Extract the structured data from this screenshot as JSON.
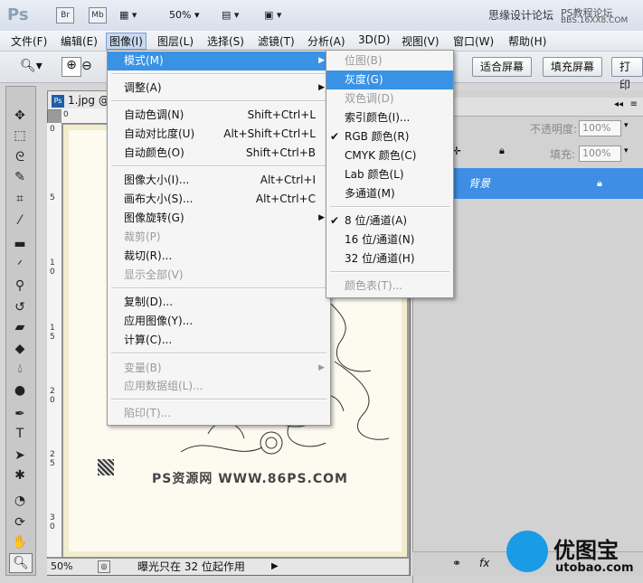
{
  "titlebar": {
    "app_logo": "Ps",
    "br_label": "Br",
    "mb_label": "Mb",
    "zoom": "50%",
    "right_text": "思缘设计论坛",
    "right_text2": "PS教程论坛",
    "right_url": "BBS.16XX8.COM"
  },
  "menubar": {
    "items": [
      "文件(F)",
      "编辑(E)",
      "图像(I)",
      "图层(L)",
      "选择(S)",
      "滤镜(T)",
      "分析(A)",
      "3D(D)",
      "视图(V)",
      "窗口(W)",
      "帮助(H)"
    ]
  },
  "options": {
    "fit_screen": "适合屏幕",
    "fill_screen": "填充屏幕",
    "print_size": "打印"
  },
  "image_menu": {
    "items": [
      {
        "label": "模式(M)",
        "shortcut": "",
        "submenu": true,
        "disabled": false,
        "highlighted": true
      },
      {
        "label": "调整(A)",
        "shortcut": "",
        "submenu": true,
        "disabled": false
      },
      {
        "label": "自动色调(N)",
        "shortcut": "Shift+Ctrl+L",
        "disabled": false
      },
      {
        "label": "自动对比度(U)",
        "shortcut": "Alt+Shift+Ctrl+L",
        "disabled": false
      },
      {
        "label": "自动颜色(O)",
        "shortcut": "Shift+Ctrl+B",
        "disabled": false
      },
      {
        "label": "图像大小(I)...",
        "shortcut": "Alt+Ctrl+I",
        "disabled": false
      },
      {
        "label": "画布大小(S)...",
        "shortcut": "Alt+Ctrl+C",
        "disabled": false
      },
      {
        "label": "图像旋转(G)",
        "shortcut": "",
        "submenu": true,
        "disabled": false
      },
      {
        "label": "裁剪(P)",
        "shortcut": "",
        "disabled": true
      },
      {
        "label": "裁切(R)...",
        "shortcut": "",
        "disabled": false
      },
      {
        "label": "显示全部(V)",
        "shortcut": "",
        "disabled": true
      },
      {
        "label": "复制(D)...",
        "shortcut": "",
        "disabled": false
      },
      {
        "label": "应用图像(Y)...",
        "shortcut": "",
        "disabled": false
      },
      {
        "label": "计算(C)...",
        "shortcut": "",
        "disabled": false
      },
      {
        "label": "变量(B)",
        "shortcut": "",
        "submenu": true,
        "disabled": true
      },
      {
        "label": "应用数据组(L)...",
        "shortcut": "",
        "disabled": true
      },
      {
        "label": "陷印(T)...",
        "shortcut": "",
        "disabled": true
      }
    ]
  },
  "mode_submenu": {
    "items": [
      {
        "label": "位图(B)",
        "disabled": true
      },
      {
        "label": "灰度(G)",
        "disabled": false,
        "highlighted": true
      },
      {
        "label": "双色调(D)",
        "disabled": true
      },
      {
        "label": "索引颜色(I)...",
        "disabled": false
      },
      {
        "label": "RGB 颜色(R)",
        "disabled": false,
        "checked": true
      },
      {
        "label": "CMYK 颜色(C)",
        "disabled": false
      },
      {
        "label": "Lab 颜色(L)",
        "disabled": false
      },
      {
        "label": "多通道(M)",
        "disabled": false
      },
      {
        "label": "8 位/通道(A)",
        "disabled": false,
        "checked": true
      },
      {
        "label": "16 位/通道(N)",
        "disabled": false
      },
      {
        "label": "32 位/通道(H)",
        "disabled": false
      },
      {
        "label": "颜色表(T)...",
        "disabled": true
      }
    ]
  },
  "document": {
    "tab_title": "1.jpg @",
    "watermark": "PS资源网 WWW.86PS.COM",
    "zoom": "50%",
    "status": "曝光只在 32 位起作用"
  },
  "layers": {
    "opacity_label": "不透明度:",
    "opacity_value": "100%",
    "fill_label": "填充:",
    "fill_value": "100%",
    "layer_name": "背景"
  },
  "logo": {
    "text_cn": "优图宝",
    "text_en": "utobao.com"
  },
  "colors": {
    "highlight": "#3a92e5",
    "layer_selected": "#3d8ee4"
  }
}
